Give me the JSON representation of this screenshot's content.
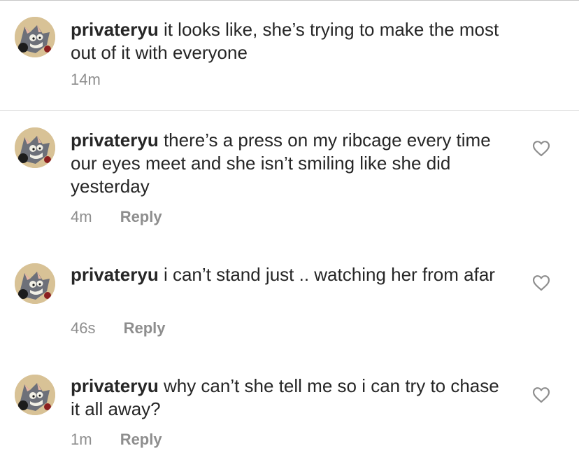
{
  "comments": [
    {
      "username": "privateryu",
      "text": " it looks like, she’s trying to make the most out of it with everyone",
      "time": "14m",
      "reply_label": "",
      "avatar_icon": "cartoon-cat-avatar",
      "has_heart": false
    },
    {
      "username": "privateryu",
      "text": " there’s a press on my ribcage every time our eyes meet and she isn’t smiling like she did yesterday",
      "time": "4m",
      "reply_label": "Reply",
      "avatar_icon": "cartoon-cat-avatar",
      "has_heart": true
    },
    {
      "username": "privateryu",
      "text": " i can’t stand just .. watching her from afar",
      "time": "46s",
      "reply_label": "Reply",
      "avatar_icon": "cartoon-cat-avatar",
      "has_heart": true
    },
    {
      "username": "privateryu",
      "text": " why can’t she tell me so i can try to chase it all away?",
      "time": "1m",
      "reply_label": "Reply",
      "avatar_icon": "cartoon-cat-avatar",
      "has_heart": true
    }
  ],
  "icons": {
    "like": "heart-outline-icon"
  },
  "colors": {
    "text": "#262626",
    "meta": "#8e8e8e",
    "divider": "#dbdbdb",
    "background": "#ffffff"
  }
}
